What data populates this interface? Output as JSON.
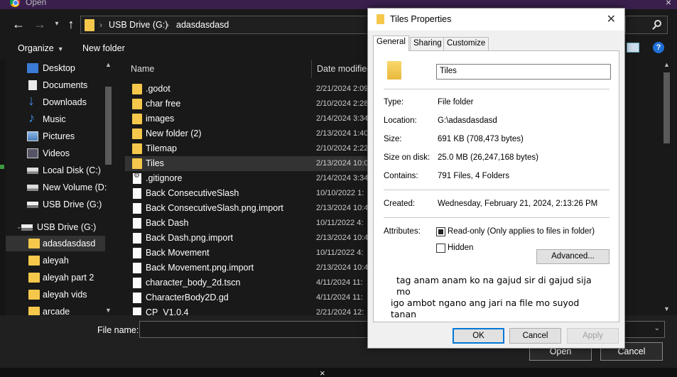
{
  "open_dialog": {
    "title": "Open",
    "address": [
      "USB Drive (G:)",
      "adasdasdasd"
    ],
    "toolbar": {
      "organize": "Organize",
      "new_folder": "New folder"
    },
    "nav_items": [
      {
        "label": "Desktop",
        "icon": "desktop-icon"
      },
      {
        "label": "Documents",
        "icon": "documents-icon"
      },
      {
        "label": "Downloads",
        "icon": "downloads-icon"
      },
      {
        "label": "Music",
        "icon": "music-icon"
      },
      {
        "label": "Pictures",
        "icon": "pictures-icon"
      },
      {
        "label": "Videos",
        "icon": "videos-icon"
      },
      {
        "label": "Local Disk (C:)",
        "icon": "drive-icon"
      },
      {
        "label": "New Volume (D:",
        "icon": "drive-icon"
      },
      {
        "label": "USB Drive (G:)",
        "icon": "usb-drive-icon"
      }
    ],
    "nav_tree": {
      "root": "USB Drive (G:)",
      "children": [
        "adasdasdasd",
        "aleyah",
        "aleyah part 2",
        "aleyah vids",
        "arcade"
      ]
    },
    "columns": {
      "name": "Name",
      "date": "Date modified"
    },
    "files": [
      {
        "name": ".godot",
        "date": "2/21/2024 2:09",
        "type": "folder"
      },
      {
        "name": "char free",
        "date": "2/10/2024 2:28",
        "type": "folder"
      },
      {
        "name": "images",
        "date": "2/14/2024 3:34",
        "type": "folder"
      },
      {
        "name": "New folder (2)",
        "date": "2/13/2024 1:40",
        "type": "folder"
      },
      {
        "name": "Tilemap",
        "date": "2/10/2024 2:22",
        "type": "folder"
      },
      {
        "name": "Tiles",
        "date": "2/13/2024 10:0",
        "type": "folder"
      },
      {
        "name": ".gitignore",
        "date": "2/14/2024 3:34",
        "type": "gear"
      },
      {
        "name": "Back ConsecutiveSlash",
        "date": "10/10/2022 1:",
        "type": "file"
      },
      {
        "name": "Back ConsecutiveSlash.png.import",
        "date": "2/13/2024 10:4",
        "type": "file"
      },
      {
        "name": "Back Dash",
        "date": "10/11/2022 4:",
        "type": "file"
      },
      {
        "name": "Back Dash.png.import",
        "date": "2/13/2024 10:4",
        "type": "file"
      },
      {
        "name": "Back Movement",
        "date": "10/11/2022 4:",
        "type": "file"
      },
      {
        "name": "Back Movement.png.import",
        "date": "2/13/2024 10:4",
        "type": "file"
      },
      {
        "name": "character_body_2d.tscn",
        "date": "4/11/2024 11:",
        "type": "file"
      },
      {
        "name": "CharacterBody2D.gd",
        "date": "4/11/2024 11:",
        "type": "file"
      },
      {
        "name": "CP_V1.0.4",
        "date": "2/21/2024 12:",
        "type": "file"
      }
    ],
    "file_name_label": "File name:",
    "open_button": "Open",
    "cancel_button": "Cancel"
  },
  "properties": {
    "title": "Tiles Properties",
    "tabs": [
      "General",
      "Sharing",
      "Customize"
    ],
    "name_value": "Tiles",
    "type_label": "Type:",
    "type_value": "File folder",
    "location_label": "Location:",
    "location_value": "G:\\adasdasdasd",
    "size_label": "Size:",
    "size_value": "691 KB (708,473 bytes)",
    "size_on_disk_label": "Size on disk:",
    "size_on_disk_value": "25.0 MB (26,247,168 bytes)",
    "contains_label": "Contains:",
    "contains_value": "791 Files, 4 Folders",
    "created_label": "Created:",
    "created_value": "Wednesday, February 21, 2024, 2:13:26 PM",
    "attributes_label": "Attributes:",
    "readonly_label": "Read-only (Only applies to files in folder)",
    "hidden_label": "Hidden",
    "advanced_button": "Advanced...",
    "note_lines": [
      "tag anam anam ko na gajud sir di gajud sija mo",
      "igo ambot ngano ang jari na file mo suyod",
      "tanan"
    ],
    "ok_button": "OK",
    "cancel_button": "Cancel",
    "apply_button": "Apply"
  },
  "taskbar": {
    "close_glyph": "×"
  }
}
